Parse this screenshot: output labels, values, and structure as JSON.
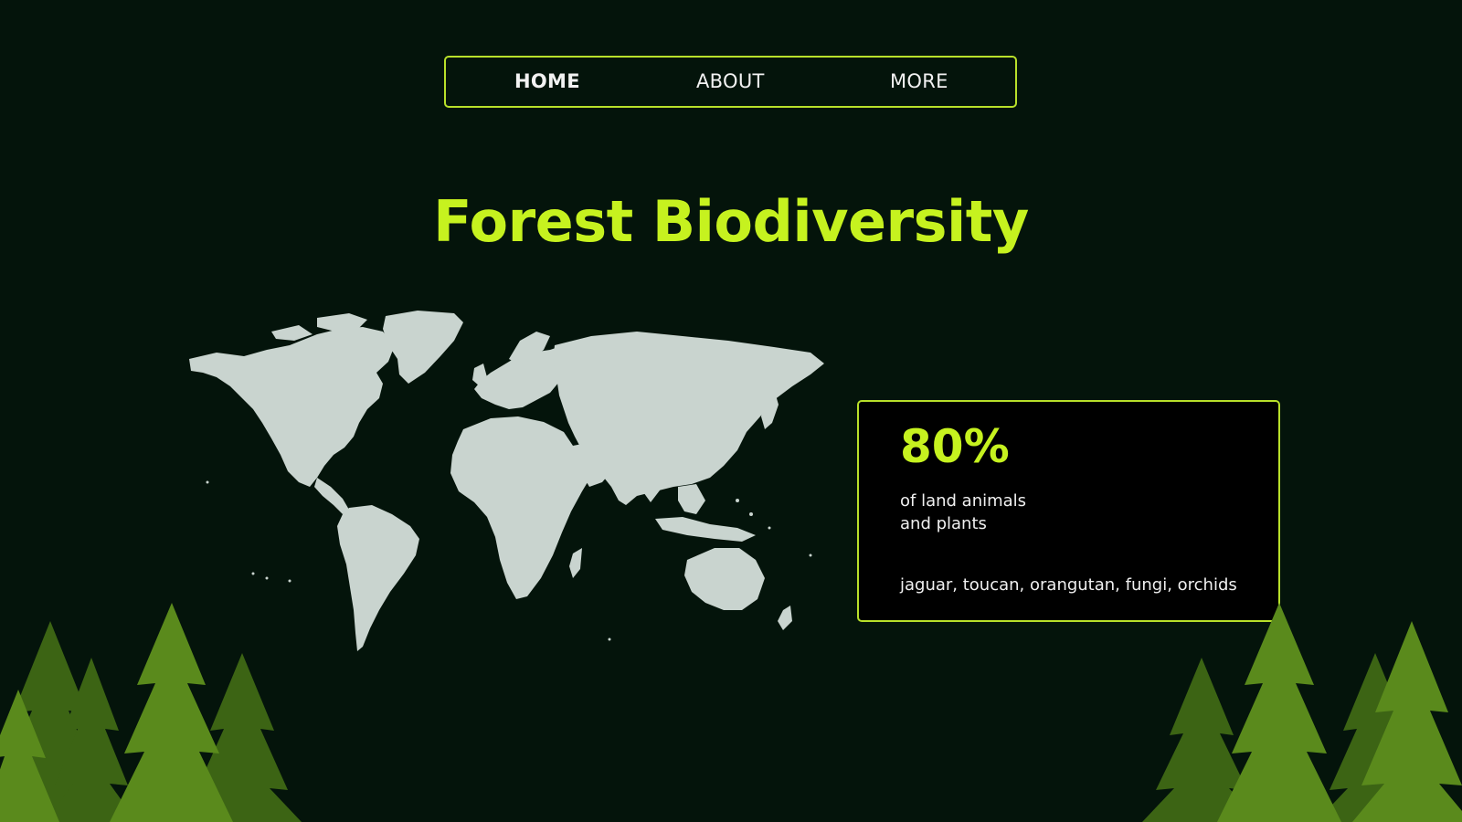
{
  "nav": {
    "home": "HOME",
    "about": "ABOUT",
    "more": "MORE"
  },
  "title": "Forest Biodiversity",
  "stat": {
    "percent": "80%",
    "desc_line1": "of land animals",
    "desc_line2": "and plants",
    "examples": "jaguar, toucan, orangutan, fungi, orchids"
  },
  "colors": {
    "background": "#04140b",
    "accent": "#c6f21f",
    "map": "#c9d4cf",
    "tree_dark": "#3c6414",
    "tree_light": "#5a8a1c"
  },
  "icons": {
    "map": "world-map-icon",
    "trees": "pine-trees-icon"
  }
}
